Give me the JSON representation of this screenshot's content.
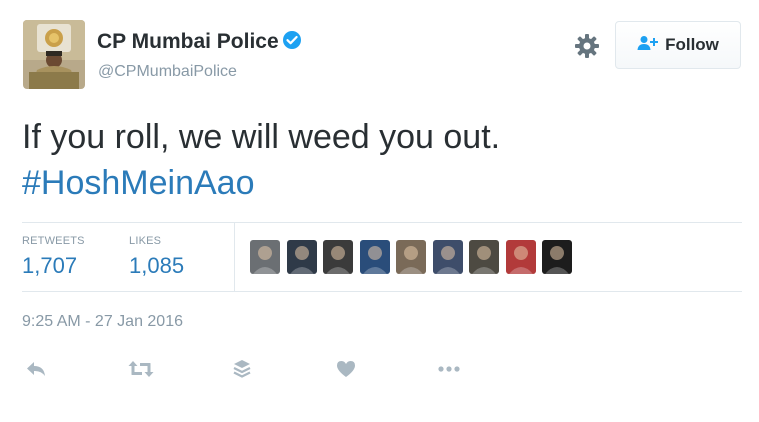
{
  "author": {
    "name": "CP Mumbai Police",
    "handle": "@CPMumbaiPolice",
    "verified": true,
    "avatar_icon": "police-officer-avatar"
  },
  "follow_button": {
    "label": "Follow",
    "icon": "add-user-icon"
  },
  "settings_icon": "gear-icon",
  "tweet": {
    "text": "If you roll, we will weed you out.",
    "hashtag": "#HoshMeinAao"
  },
  "stats": {
    "retweets": {
      "label": "RETWEETS",
      "value": "1,707"
    },
    "likes": {
      "label": "LIKES",
      "value": "1,085"
    }
  },
  "likers": [
    {
      "name": "liker-1",
      "color": "#6b6f73"
    },
    {
      "name": "liker-2",
      "color": "#2f3a48"
    },
    {
      "name": "liker-3",
      "color": "#3b3b3b"
    },
    {
      "name": "liker-4",
      "color": "#2a4d7a"
    },
    {
      "name": "liker-5",
      "color": "#7a6a58"
    },
    {
      "name": "liker-6",
      "color": "#3e4d6a"
    },
    {
      "name": "liker-7",
      "color": "#4d4a42"
    },
    {
      "name": "liker-8",
      "color": "#b23a3a"
    },
    {
      "name": "liker-9",
      "color": "#1d1d1d"
    }
  ],
  "timestamp": "9:25 AM - 27 Jan 2016",
  "actions": [
    "reply-icon",
    "retweet-icon",
    "stack-icon",
    "heart-icon",
    "more-icon"
  ],
  "colors": {
    "link": "#2b7bb9",
    "muted": "#8899a6",
    "text": "#292f33",
    "verified": "#1da1f2",
    "border": "#e1e8ed"
  }
}
